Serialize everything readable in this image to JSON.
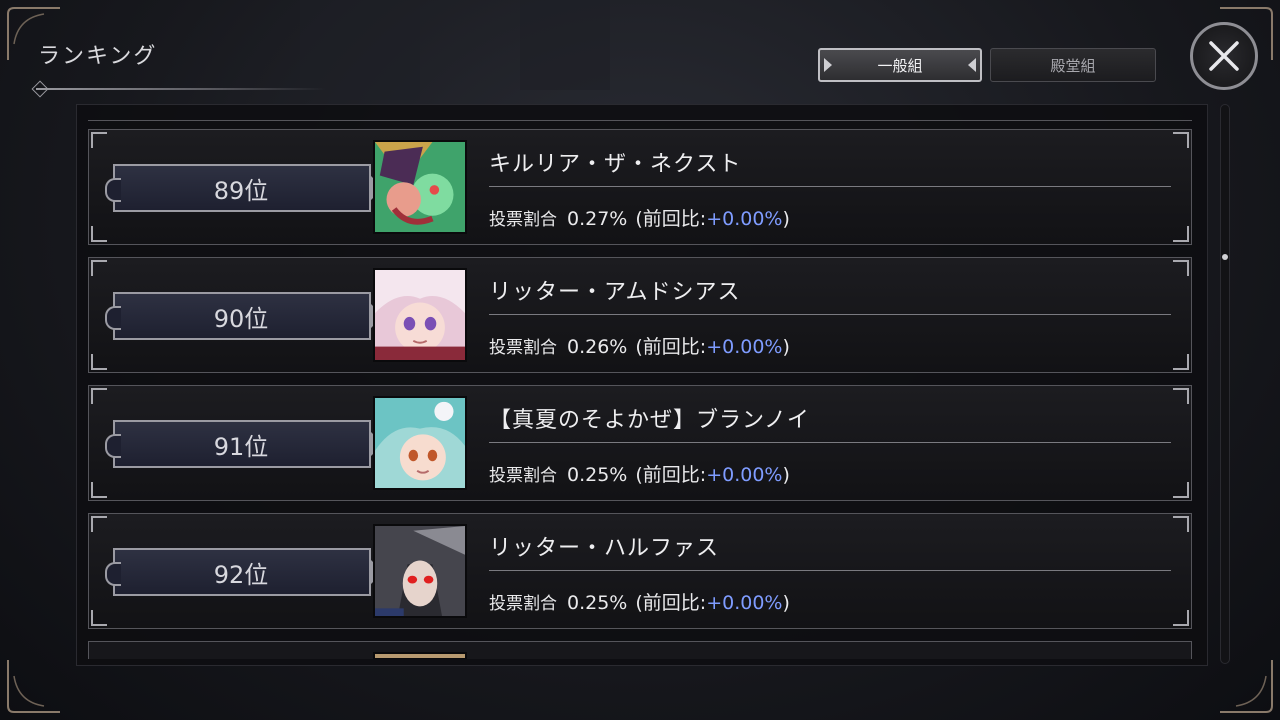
{
  "header": {
    "title": "ランキング",
    "tabs": [
      {
        "label": "一般組",
        "active": true
      },
      {
        "label": "殿堂組",
        "active": false
      }
    ],
    "close_icon": "close-icon"
  },
  "colors": {
    "delta_positive": "#7f9cff",
    "panel_bg": "#121215",
    "frame": "#9b9ba3"
  },
  "ranking": {
    "vote_label": "投票割合",
    "prev_open": "(前回比:",
    "prev_close": ")",
    "rows": [
      {
        "rank": "89位",
        "name": "キルリア・ザ・ネクスト",
        "share": "0.27%",
        "delta": "+0.00%"
      },
      {
        "rank": "90位",
        "name": "リッター・アムドシアス",
        "share": "0.26%",
        "delta": "+0.00%"
      },
      {
        "rank": "91位",
        "name": "【真夏のそよかぜ】ブランノイ",
        "share": "0.25%",
        "delta": "+0.00%"
      },
      {
        "rank": "92位",
        "name": "リッター・ハルファス",
        "share": "0.25%",
        "delta": "+0.00%"
      }
    ]
  }
}
